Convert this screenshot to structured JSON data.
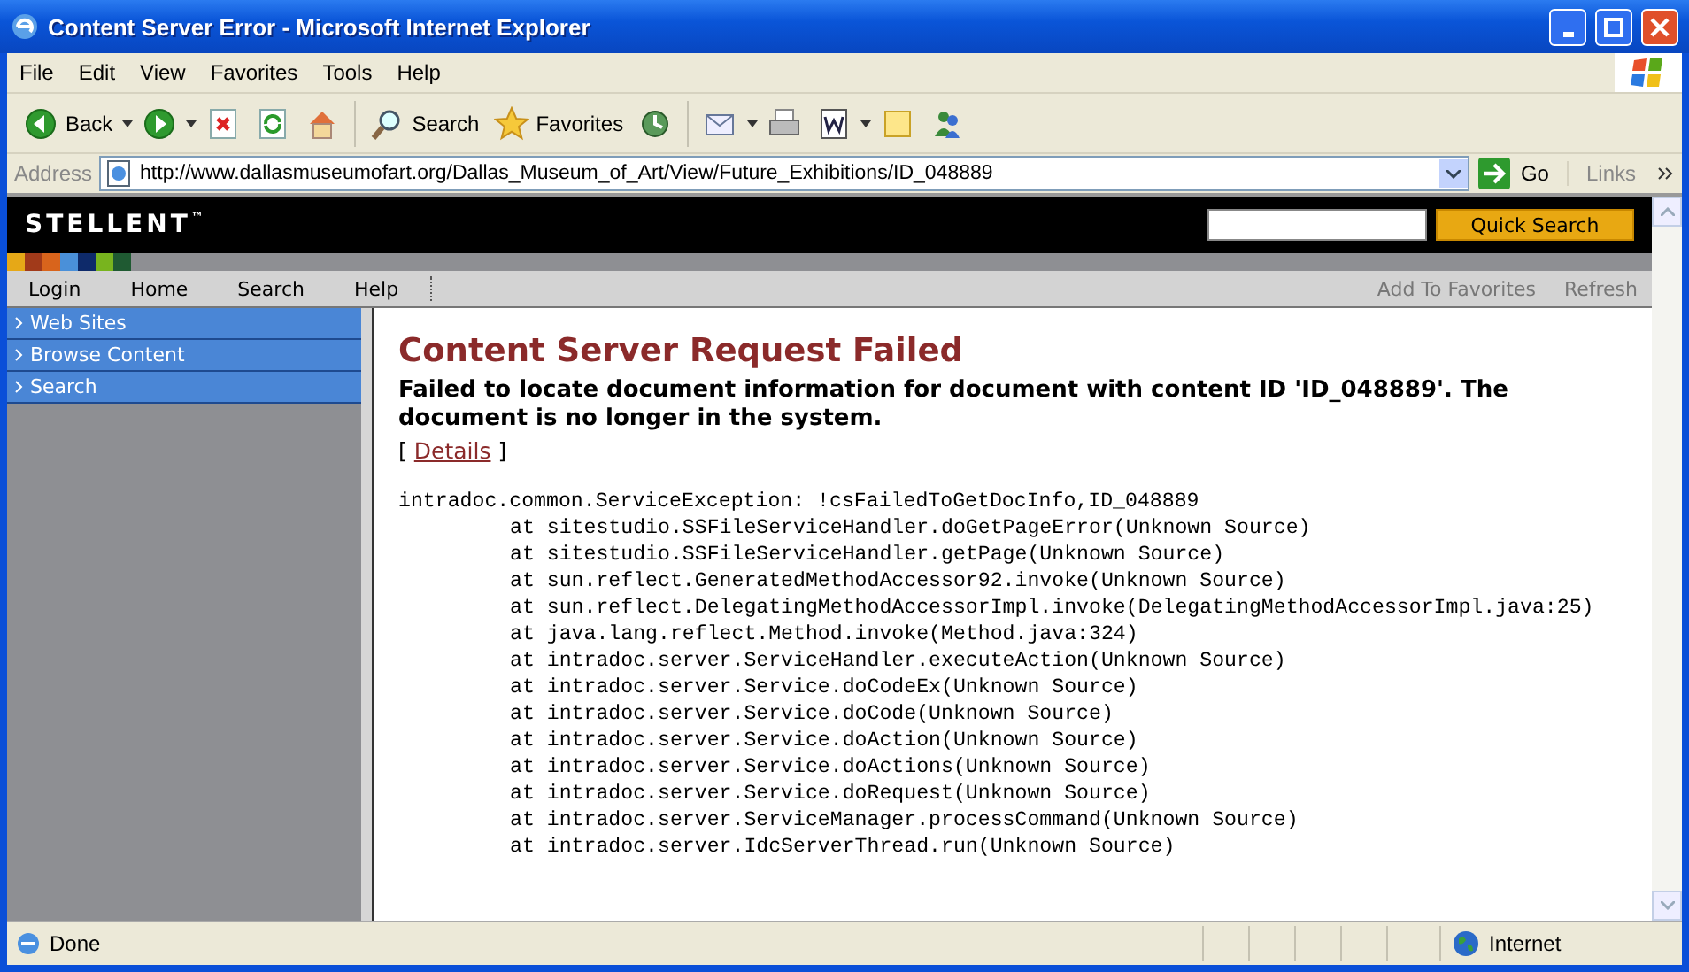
{
  "window": {
    "title": "Content Server Error - Microsoft Internet Explorer"
  },
  "menu": [
    "File",
    "Edit",
    "View",
    "Favorites",
    "Tools",
    "Help"
  ],
  "toolbar": [
    {
      "kind": "back",
      "label": "Back"
    },
    {
      "kind": "forward"
    },
    {
      "kind": "stop"
    },
    {
      "kind": "refresh"
    },
    {
      "kind": "home"
    },
    {
      "kind": "search",
      "label": "Search"
    },
    {
      "kind": "favorites",
      "label": "Favorites"
    },
    {
      "kind": "history"
    },
    {
      "kind": "mail"
    },
    {
      "kind": "print"
    },
    {
      "kind": "edit"
    },
    {
      "kind": "discuss"
    },
    {
      "kind": "messenger"
    }
  ],
  "address": {
    "label": "Address",
    "url": "http://www.dallasmuseumofart.org/Dallas_Museum_of_Art/View/Future_Exhibitions/ID_048889",
    "go": "Go",
    "links": "Links"
  },
  "site": {
    "logo": "STELLENT",
    "logo_mark": "™",
    "search_button": "Quick Search",
    "nav_left": [
      "Login",
      "Home",
      "Search",
      "Help"
    ],
    "nav_right": [
      "Add To Favorites",
      "Refresh"
    ],
    "sidebar": [
      "Web Sites",
      "Browse Content",
      "Search"
    ]
  },
  "content": {
    "heading": "Content Server Request Failed",
    "message": "Failed to locate document information for document with content ID 'ID_048889'. The document is no longer in the system.",
    "details_open": "[",
    "details_link": "Details",
    "details_close": "]",
    "trace": [
      {
        "kind": "exception",
        "text": "intradoc.common.ServiceException: !csFailedToGetDocInfo,ID_048889"
      },
      {
        "kind": "frame",
        "text": "at sitestudio.SSFileServiceHandler.doGetPageError(Unknown Source)"
      },
      {
        "kind": "frame",
        "text": "at sitestudio.SSFileServiceHandler.getPage(Unknown Source)"
      },
      {
        "kind": "frame",
        "text": "at sun.reflect.GeneratedMethodAccessor92.invoke(Unknown Source)"
      },
      {
        "kind": "frame",
        "text": "at sun.reflect.DelegatingMethodAccessorImpl.invoke(DelegatingMethodAccessorImpl.java:25)"
      },
      {
        "kind": "frame",
        "text": "at java.lang.reflect.Method.invoke(Method.java:324)"
      },
      {
        "kind": "frame",
        "text": "at intradoc.server.ServiceHandler.executeAction(Unknown Source)"
      },
      {
        "kind": "frame",
        "text": "at intradoc.server.Service.doCodeEx(Unknown Source)"
      },
      {
        "kind": "frame",
        "text": "at intradoc.server.Service.doCode(Unknown Source)"
      },
      {
        "kind": "frame",
        "text": "at intradoc.server.Service.doAction(Unknown Source)"
      },
      {
        "kind": "frame",
        "text": "at intradoc.server.Service.doActions(Unknown Source)"
      },
      {
        "kind": "frame",
        "text": "at intradoc.server.Service.doRequest(Unknown Source)"
      },
      {
        "kind": "frame",
        "text": "at intradoc.server.ServiceManager.processCommand(Unknown Source)"
      },
      {
        "kind": "frame",
        "text": "at intradoc.server.IdcServerThread.run(Unknown Source)"
      }
    ]
  },
  "status_bar": {
    "text": "Done",
    "zone": "Internet"
  }
}
